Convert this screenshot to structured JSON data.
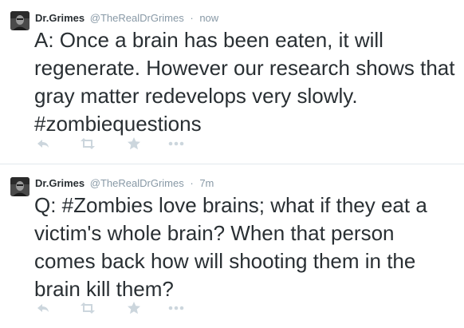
{
  "tweets": [
    {
      "fullname": "Dr.Grimes",
      "username": "@TheRealDrGrimes",
      "separator": "·",
      "time": "now",
      "text": "A: Once a brain has been eaten, it will regenerate. However our research shows that gray matter redevelops very slowly. #zombiequestions"
    },
    {
      "fullname": "Dr.Grimes",
      "username": "@TheRealDrGrimes",
      "separator": "·",
      "time": "7m",
      "text": "Q: #Zombies love brains; what if they eat a victim's whole brain? When that person comes back how will shooting them in the brain kill them?"
    }
  ],
  "actions": {
    "reply_icon": "reply-icon",
    "retweet_icon": "retweet-icon",
    "favorite_icon": "star-icon",
    "more_icon": "more-icon"
  },
  "colors": {
    "text": "#292f33",
    "muted": "#8899a6",
    "icon": "#ccd6dd",
    "divider": "#e1e8ed"
  }
}
